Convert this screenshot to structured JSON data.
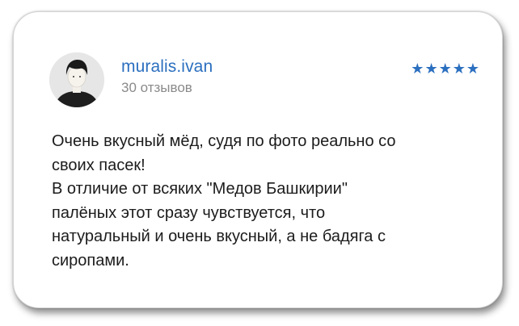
{
  "review": {
    "author": {
      "name": "muralis.ivan",
      "reviews_count": "30 отзывов",
      "avatar_icon": "user-avatar-icon"
    },
    "rating": {
      "stars": 5,
      "max_stars": 5,
      "star_symbol": "★",
      "color": "#2b6fbf"
    },
    "text_lines": [
      "Очень вкусный мёд, судя по фото реально со",
      "своих пасек!",
      "В отличие от всяких \"Медов Башкирии\"",
      "палёных этот сразу чувствуется, что",
      "натуральный и очень вкусный, а не бадяга с",
      "сиропами."
    ]
  },
  "colors": {
    "accent": "#2b6fbf",
    "muted_text": "#8a8a8a",
    "body_text": "#1c1c1c"
  }
}
